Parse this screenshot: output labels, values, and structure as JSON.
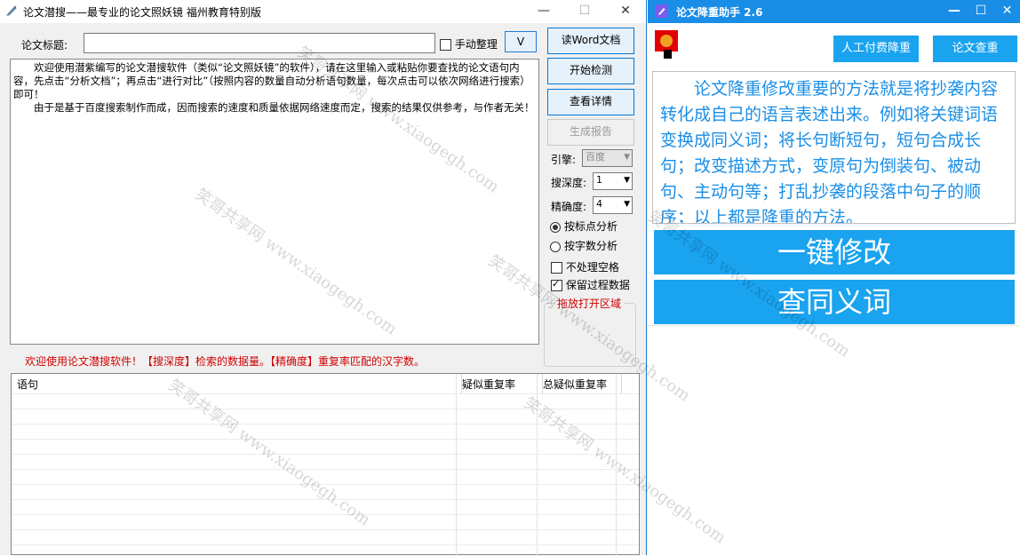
{
  "left_window": {
    "title": "论文潜搜——最专业的论文照妖镜 福州教育特别版",
    "controls": {
      "minimize": "—",
      "maximize": "☐",
      "close": "✕"
    },
    "title_label": "论文标题:",
    "title_input_value": "",
    "manual_label": "手动整理",
    "manual_checked": false,
    "v_button": "V",
    "intro_paragraphs": [
      "欢迎使用潜紫编写的论文潜搜软件（类似“论文照妖镜”的软件），请在这里输入或粘贴你要查找的论文语句内容，先点击“分析文档”；再点击“进行对比”（按照内容的数量自动分析语句数量，每次点击可以依次网络进行搜索）即可！",
      "由于是基于百度搜索制作而成，因而搜索的速度和质量依据网络速度而定，搜索的结果仅供参考，与作者无关！"
    ],
    "buttons": {
      "read_word": "读Word文档",
      "start_check": "开始检测",
      "view_details": "查看详情",
      "generate_report": "生成报告"
    },
    "engine_label": "引擎:",
    "engine_value": "百度",
    "depth_label": "搜深度:",
    "depth_value": "1",
    "precision_label": "精确度:",
    "precision_value": "4",
    "radio_punct": "按标点分析",
    "radio_chars": "按字数分析",
    "chk_no_space": "不处理空格",
    "chk_keep_data": "保留过程数据",
    "drop_area": "拖放打开区域",
    "status_text": "欢迎使用论文潜搜软件！【搜深度】检索的数据量。【精确度】重复率匹配的汉字数。",
    "table_headers": [
      "语句",
      "疑似重复率",
      "总疑似重复率"
    ]
  },
  "right_window": {
    "title": "论文降重助手 2.6",
    "controls": {
      "minimize": "—",
      "maximize": "☐",
      "close": "✕"
    },
    "btn_manual": "人工付费降重",
    "btn_check": "论文查重",
    "tip": "论文降重修改重要的方法就是将抄袭内容转化成自己的语言表述出来。例如将关键词语变换成同义词；将长句断短句，短句合成长句；改变描述方式，变原句为倒装句、被动句、主动句等；打乱抄袭的段落中句子的顺序；以上都是降重的方法。",
    "btn_one_key": "一键修改",
    "btn_synonym": "查同义词"
  },
  "watermark": "笑哥共享网 www.xiaogegh.com",
  "colors": {
    "accent_blue": "#1aa3ef",
    "title_blue": "#1a8ee6",
    "alert_red": "#d00000"
  }
}
